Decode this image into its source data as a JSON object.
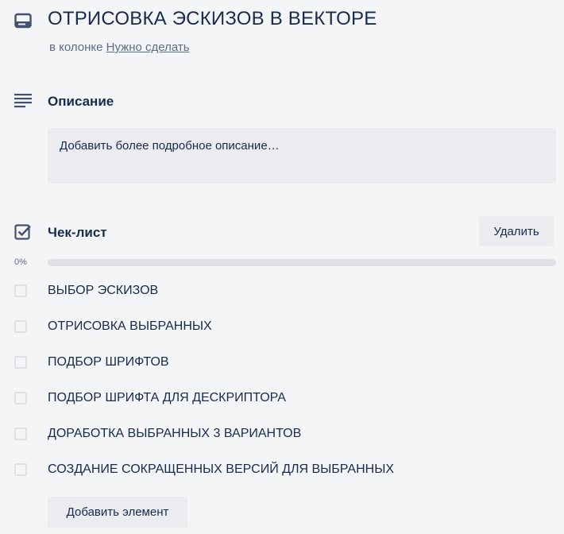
{
  "card": {
    "title": "ОТРИСОВКА ЭСКИЗОВ В ВЕКТОРЕ",
    "list_prefix": "в колонке",
    "list_name": "Нужно сделать",
    "icon": "card-icon"
  },
  "description": {
    "title": "Описание",
    "placeholder": "Добавить более подробное описание…",
    "icon": "lines-icon"
  },
  "checklist": {
    "title": "Чек-лист",
    "delete_label": "Удалить",
    "progress_label": "0%",
    "progress_value": 0,
    "icon": "checkbox-checked-icon",
    "items": [
      {
        "label": "ВЫБОР ЭСКИЗОВ",
        "checked": false
      },
      {
        "label": "ОТРИСОВКА ВЫБРАННЫХ",
        "checked": false
      },
      {
        "label": "ПОДБОР ШРИФТОВ",
        "checked": false
      },
      {
        "label": "ПОДБОР ШРИФТА ДЛЯ ДЕСКРИПТОРА",
        "checked": false
      },
      {
        "label": "ДОРАБОТКА ВЫБРАННЫХ 3 ВАРИАНТОВ",
        "checked": false
      },
      {
        "label": "СОЗДАНИЕ СОКРАЩЕННЫХ ВЕРСИЙ ДЛЯ ВЫБРАННЫХ",
        "checked": false
      }
    ],
    "add_label": "Добавить элемент"
  },
  "colors": {
    "text": "#172b4d",
    "muted": "#5e6c84",
    "button_bg": "#ebecf0",
    "page_bg": "#f4f5f7"
  }
}
